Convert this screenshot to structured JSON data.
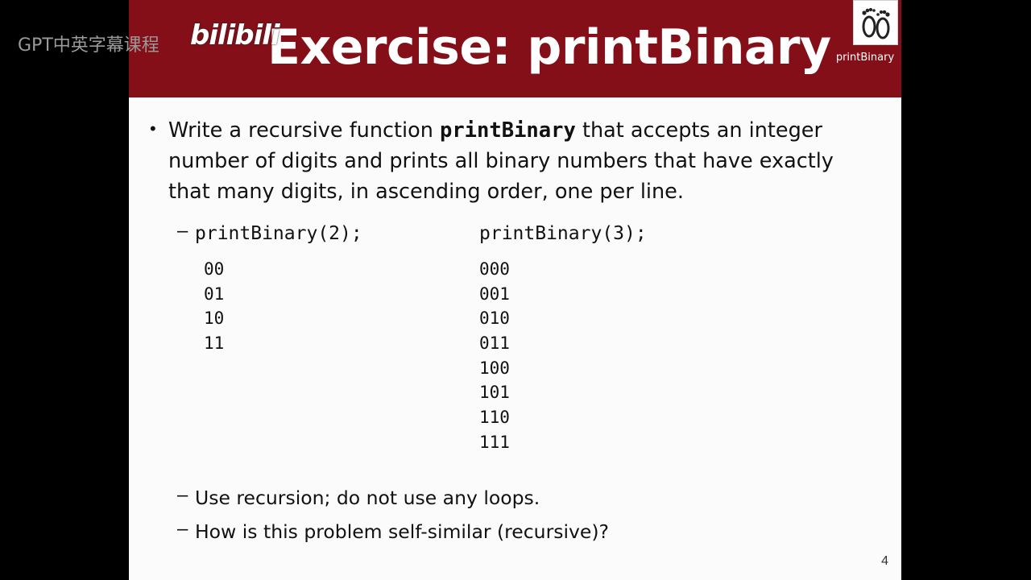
{
  "overlay": {
    "channel": "GPT中英字幕课程",
    "brand": "bilibili"
  },
  "slide": {
    "title": "Exercise: printBinary",
    "logo_caption": "printBinary",
    "bullet": {
      "pre": "Write a recursive function ",
      "keyword": "printBinary",
      "post": " that accepts an integer number of digits and prints all binary numbers that have exactly that many digits, in ascending order, one per line."
    },
    "example_left": {
      "call": "printBinary(2);",
      "output": [
        "00",
        "01",
        "10",
        "11"
      ]
    },
    "example_right": {
      "call": "printBinary(3);",
      "output": [
        "000",
        "001",
        "010",
        "011",
        "100",
        "101",
        "110",
        "111"
      ]
    },
    "sub_bullets": [
      "Use recursion; do not use any loops.",
      "How is this problem self-similar (recursive)?"
    ],
    "page_number": "4"
  },
  "colors": {
    "title_bar": "#850f18",
    "slide_background": "#fbfbfb",
    "letterbox": "#000000"
  }
}
